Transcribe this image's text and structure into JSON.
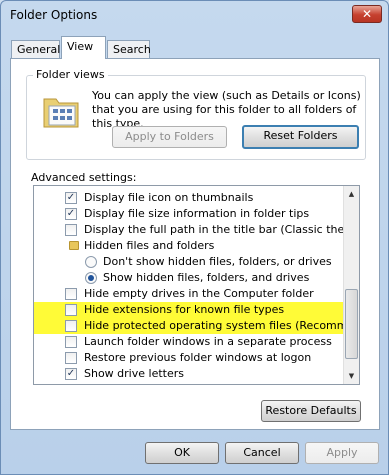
{
  "window": {
    "title": "Folder Options",
    "close_symbol": "✕"
  },
  "tabs": [
    {
      "label": "General"
    },
    {
      "label": "View"
    },
    {
      "label": "Search"
    }
  ],
  "folder_views": {
    "label": "Folder views",
    "description": "You can apply the view (such as Details or Icons) that you are using for this folder to all folders of this type.",
    "apply_label": "Apply to Folders",
    "reset_label": "Reset Folders"
  },
  "advanced": {
    "label": "Advanced settings:",
    "items": [
      {
        "label": "Display file icon on thumbnails",
        "checked": true
      },
      {
        "label": "Display file size information in folder tips",
        "checked": true
      },
      {
        "label": "Display the full path in the title bar (Classic theme only)",
        "checked": false
      },
      {
        "label": "Hidden files and folders"
      },
      {
        "label": "Don't show hidden files, folders, or drives",
        "selected": false
      },
      {
        "label": "Show hidden files, folders, and drives",
        "selected": true
      },
      {
        "label": "Hide empty drives in the Computer folder",
        "checked": false
      },
      {
        "label": "Hide extensions for known file types",
        "checked": false,
        "highlighted": true
      },
      {
        "label": "Hide protected operating system files (Recommended)",
        "checked": false,
        "highlighted": true
      },
      {
        "label": "Launch folder windows in a separate process",
        "checked": false
      },
      {
        "label": "Restore previous folder windows at logon",
        "checked": false
      },
      {
        "label": "Show drive letters",
        "checked": true
      }
    ],
    "restore_defaults_label": "Restore Defaults"
  },
  "footer": {
    "ok_label": "OK",
    "cancel_label": "Cancel",
    "apply_label": "Apply"
  },
  "icons": {
    "check": "✓",
    "scroll_up": "▲",
    "scroll_down": "▼"
  },
  "colors": {
    "highlight": "#fffb37",
    "focus_border": "#3c7fb1",
    "close_button": "#c6402f"
  }
}
